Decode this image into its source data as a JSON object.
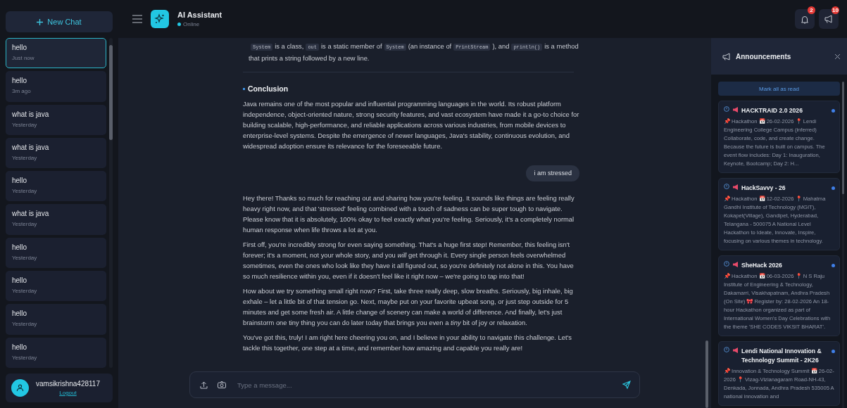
{
  "sidebar": {
    "new_chat": "New Chat",
    "chats": [
      {
        "title": "hello",
        "time": "Just now",
        "selected": true
      },
      {
        "title": "hello",
        "time": "3m ago",
        "selected": false
      },
      {
        "title": "what is java",
        "time": "Yesterday",
        "selected": false
      },
      {
        "title": "what is java",
        "time": "Yesterday",
        "selected": false
      },
      {
        "title": "hello",
        "time": "Yesterday",
        "selected": false
      },
      {
        "title": "what is java",
        "time": "Yesterday",
        "selected": false
      },
      {
        "title": "hello",
        "time": "Yesterday",
        "selected": false
      },
      {
        "title": "hello",
        "time": "Yesterday",
        "selected": false
      },
      {
        "title": "hello",
        "time": "Yesterday",
        "selected": false
      },
      {
        "title": "hello",
        "time": "Yesterday",
        "selected": false
      }
    ],
    "user": {
      "name": "vamsikrishna428117",
      "logout": "Logout"
    }
  },
  "header": {
    "title": "AI Assistant",
    "status": "Online",
    "notifications": "2",
    "announcements": "10"
  },
  "messages": [
    {
      "kind": "assistant",
      "blocks": [
        {
          "kind": "lines",
          "lines": [
            [
              {
                "kind": "code",
                "text": "System"
              },
              {
                "kind": "text",
                "text": "is a class,"
              },
              {
                "kind": "code",
                "text": "out"
              },
              {
                "kind": "text",
                "text": "is a static member of"
              },
              {
                "kind": "code",
                "text": "System"
              },
              {
                "kind": "text",
                "text": "(an instance of"
              },
              {
                "kind": "code",
                "text": "PrintStream"
              },
              {
                "kind": "text",
                "text": "), and"
              },
              {
                "kind": "code",
                "text": "println()"
              },
              {
                "kind": "text",
                "text": "is a method"
              }
            ],
            [
              {
                "kind": "text",
                "text": "that prints a string followed by a new line."
              }
            ]
          ]
        },
        {
          "kind": "rule"
        },
        {
          "kind": "heading",
          "text": "Conclusion"
        },
        {
          "kind": "paragraph",
          "text": "Java remains one of the most popular and influential programming languages in the world. Its robust platform independence, object-oriented nature, strong security features, and vast ecosystem have made it a go-to choice for building scalable, high-performance, and reliable applications across various industries, from mobile devices to enterprise-level systems. Despite the emergence of newer languages, Java's stability, continuous evolution, and widespread adoption ensure its relevance for the foreseeable future."
        }
      ]
    },
    {
      "kind": "user",
      "text": "i am stressed"
    },
    {
      "kind": "assistant",
      "blocks": [
        {
          "kind": "paragraph",
          "text": "Hey there! Thanks so much for reaching out and sharing how you're feeling. It sounds like things are feeling really heavy right now, and that 'stressed' feeling combined with a touch of sadness can be super tough to navigate. Please know that it is absolutely, 100% okay to feel exactly what you're feeling. Seriously, it's a completely normal human response when life throws a lot at you."
        },
        {
          "kind": "paragraph",
          "text": "First off, you're incredibly strong for even saying something. That's a huge first step! Remember, this feeling isn't forever; it's a moment, not your whole story, and you *will* get through it. Every single person feels overwhelmed sometimes, even the ones who look like they have it all figured out, so you're definitely not alone in this. You have so much resilience within you, even if it doesn't feel like it right now – we're going to tap into that!"
        },
        {
          "kind": "paragraph",
          "text": "How about we try something small right now? First, take three really deep, slow breaths. Seriously, big inhale, big exhale – let a little bit of that tension go. Next, maybe put on your favorite upbeat song, or just step outside for 5 minutes and get some fresh air. A little change of scenery can make a world of difference. And finally, let's just brainstorm one tiny thing you can do later today that brings you even a *tiny* bit of joy or relaxation."
        },
        {
          "kind": "paragraph",
          "text": "You've got this, truly! I am right here cheering you on, and I believe in your ability to navigate this challenge. Let's tackle this together, one step at a time, and remember how amazing and capable you really are!"
        }
      ]
    }
  ],
  "input": {
    "placeholder": "Type a message..."
  },
  "announcements": {
    "title": "Announcements",
    "mark_all": "Mark all as read",
    "items": [
      {
        "title": "HACKTRAID 2.0 2026",
        "unread": true,
        "text": "📌 Hackathon 📅 26-02-2026 📍 Lendi Engineering College Campus (inferred) Collaborate, code, and create change. Because the future is built on campus. The event flow includes: Day 1: Inauguration, Keynote, Bootcamp; Day 2: H..."
      },
      {
        "title": "HackSavvy - 26",
        "unread": true,
        "text": "📌 Hackathon 📅 12-02-2026 📍 Mahatma Gandhi Institute of Technology (MGIT), Kokapet(Village), Gandipet, Hyderabad, Telangana - 500075 A National Level Hackathon to Ideate, Innovate, Inspire, focusing on various themes in technology."
      },
      {
        "title": "SheHack 2026",
        "unread": true,
        "text": "📌 Hackathon 📅 06-03-2026 📍 N S Raju Institute of Engineering & Technology, Dakamarri, Visakhapatnam, Andhra Pradesh (On Site) 🎀 Register by: 28-02-2026 An 18-hour Hackathon organized as part of International Women's Day Celebrations with the theme 'SHE CODES VIKSIT BHARAT'."
      },
      {
        "title": "Lendi National Innovation & Technology Summit - 2K26",
        "unread": true,
        "text": "📌 Innovation & Technology Summit 📅 26-02-2026 📍 Vizag-Vizianagaram Road-NH-43, Denkada, Jonnada, Andhra Pradesh 535005 A national innovation and"
      }
    ]
  }
}
